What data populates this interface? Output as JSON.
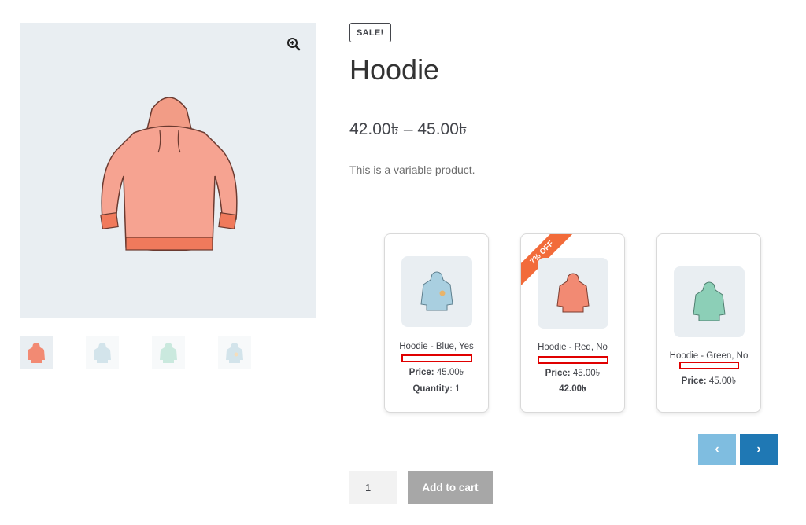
{
  "gallery": {
    "zoom_icon": "zoom-in-icon",
    "thumbnails": [
      {
        "color": "#f28a73"
      },
      {
        "color": "#9fc4d3"
      },
      {
        "color": "#8ccfb7"
      },
      {
        "color": "#9fc4d3"
      }
    ]
  },
  "product": {
    "sale_badge": "SALE!",
    "title": "Hoodie",
    "price_range": "42.00৳ – 45.00৳",
    "description": "This is a variable product."
  },
  "variations": [
    {
      "name": "Hoodie - Blue, Yes",
      "price_label": "Price:",
      "price": "45.00৳",
      "quantity_label": "Quantity:",
      "quantity": "1",
      "color": "#a9cfe0"
    },
    {
      "ribbon": "7% OFF",
      "name": "Hoodie - Red, No",
      "price_label": "Price:",
      "old_price": "45.00৳",
      "sale_price": "42.00৳",
      "color": "#f28a73"
    },
    {
      "name": "Hoodie - Green, No",
      "price_label": "Price:",
      "price": "45.00৳",
      "color": "#8ccfb7"
    }
  ],
  "slider": {
    "prev_icon": "chevron-left-icon",
    "next_icon": "chevron-right-icon"
  },
  "cart": {
    "quantity": "1",
    "add_to_cart_label": "Add to cart"
  },
  "colors": {
    "accent_blue": "#1f78b4",
    "light_blue": "#7fbde0",
    "sale_orange": "#f26b3a",
    "highlight_red": "#e00000"
  }
}
